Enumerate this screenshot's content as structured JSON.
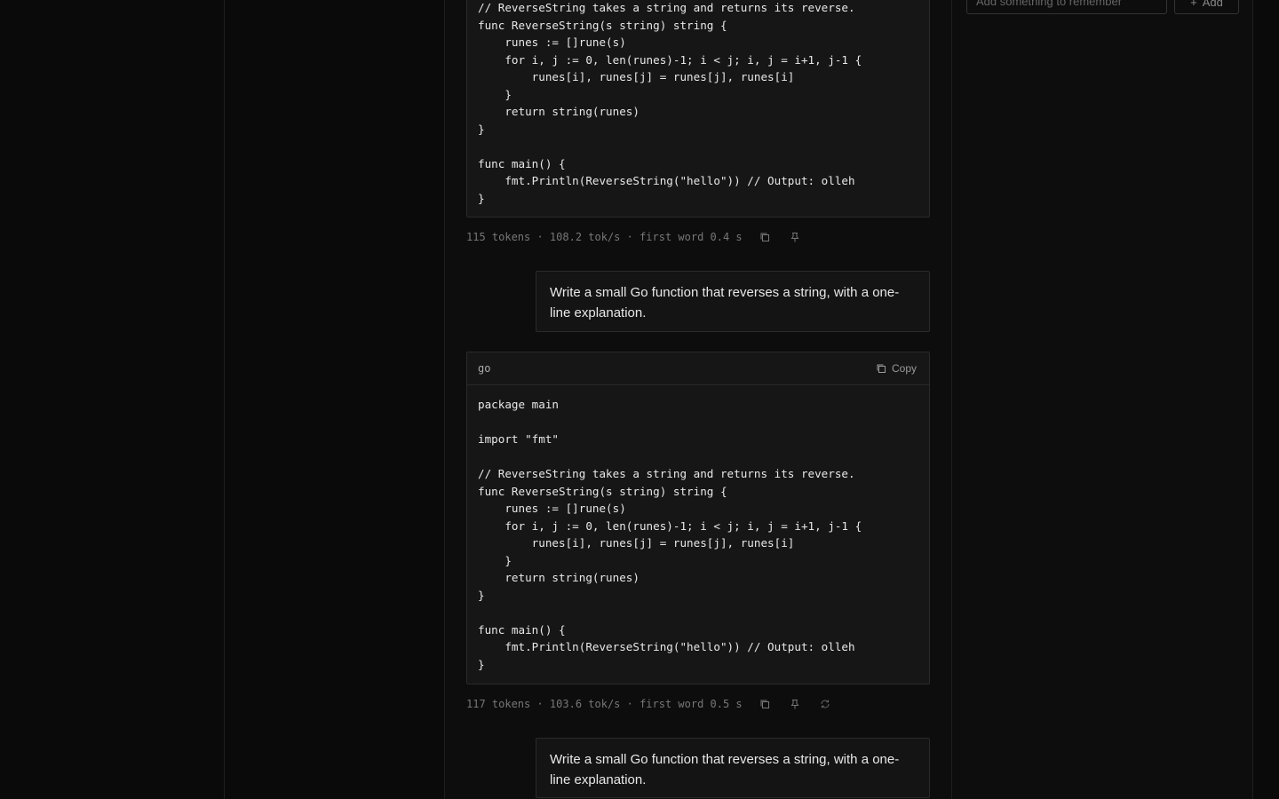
{
  "memory": {
    "input_placeholder": "Add something to remember",
    "add_label": "Add"
  },
  "messages": [
    {
      "code_tail": "// ReverseString takes a string and returns its reverse.\nfunc ReverseString(s string) string {\n    runes := []rune(s)\n    for i, j := 0, len(runes)-1; i < j; i, j = i+1, j-1 {\n        runes[i], runes[j] = runes[j], runes[i]\n    }\n    return string(runes)\n}\n\nfunc main() {\n    fmt.Println(ReverseString(\"hello\")) // Output: olleh\n}",
      "stats": "115 tokens · 108.2 tok/s · first word 0.4 s"
    },
    {
      "user_text": "Write a small Go function that reverses a string, with a one-line explanation."
    },
    {
      "language": "go",
      "copy_label": "Copy",
      "code": "package main\n\nimport \"fmt\"\n\n// ReverseString takes a string and returns its reverse.\nfunc ReverseString(s string) string {\n    runes := []rune(s)\n    for i, j := 0, len(runes)-1; i < j; i, j = i+1, j-1 {\n        runes[i], runes[j] = runes[j], runes[i]\n    }\n    return string(runes)\n}\n\nfunc main() {\n    fmt.Println(ReverseString(\"hello\")) // Output: olleh\n}",
      "stats": "117 tokens · 103.6 tok/s · first word 0.5 s"
    },
    {
      "user_text": "Write a small Go function that reverses a string, with a one-line explanation."
    }
  ],
  "icons": {
    "copy": "copy-icon",
    "pin": "pin-icon",
    "regenerate": "regenerate-icon"
  }
}
